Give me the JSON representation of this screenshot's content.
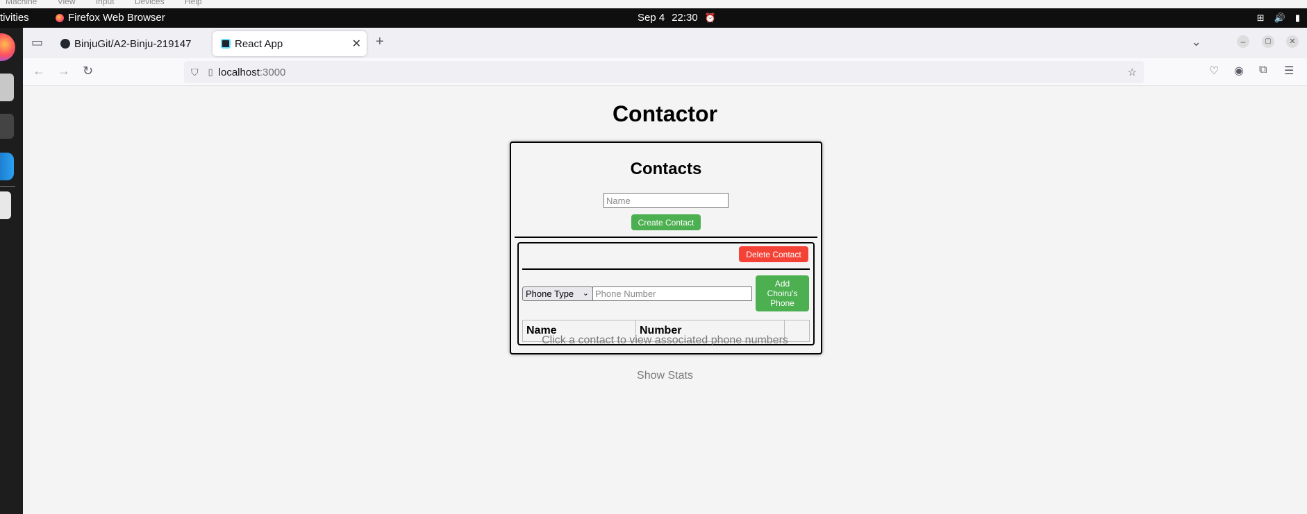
{
  "vm_menu": {
    "items": [
      "Machine",
      "View",
      "Input",
      "Devices",
      "Help"
    ]
  },
  "topbar": {
    "activities": "tivities",
    "app_name": "Firefox Web Browser",
    "date": "Sep 4",
    "time": "22:30"
  },
  "browser": {
    "tabs": [
      {
        "label": "BinjuGit/A2-Binju-219147",
        "icon": "github-icon"
      },
      {
        "label": "React App",
        "icon": "react-icon"
      }
    ],
    "url": {
      "host": "localhost",
      "port": ":3000"
    }
  },
  "app": {
    "title": "Contactor",
    "card": {
      "title": "Contacts",
      "name_placeholder": "Name",
      "create_label": "Create Contact",
      "delete_label": "Delete Contact",
      "phone_type_selected": "Phone Type",
      "phone_placeholder": "Phone Number",
      "add_phone_label": "Add Choiru's Phone",
      "table_headers": [
        "Name",
        "Number",
        ""
      ]
    },
    "hint": "Click a contact to view associated phone numbers",
    "show_stats": "Show Stats"
  }
}
